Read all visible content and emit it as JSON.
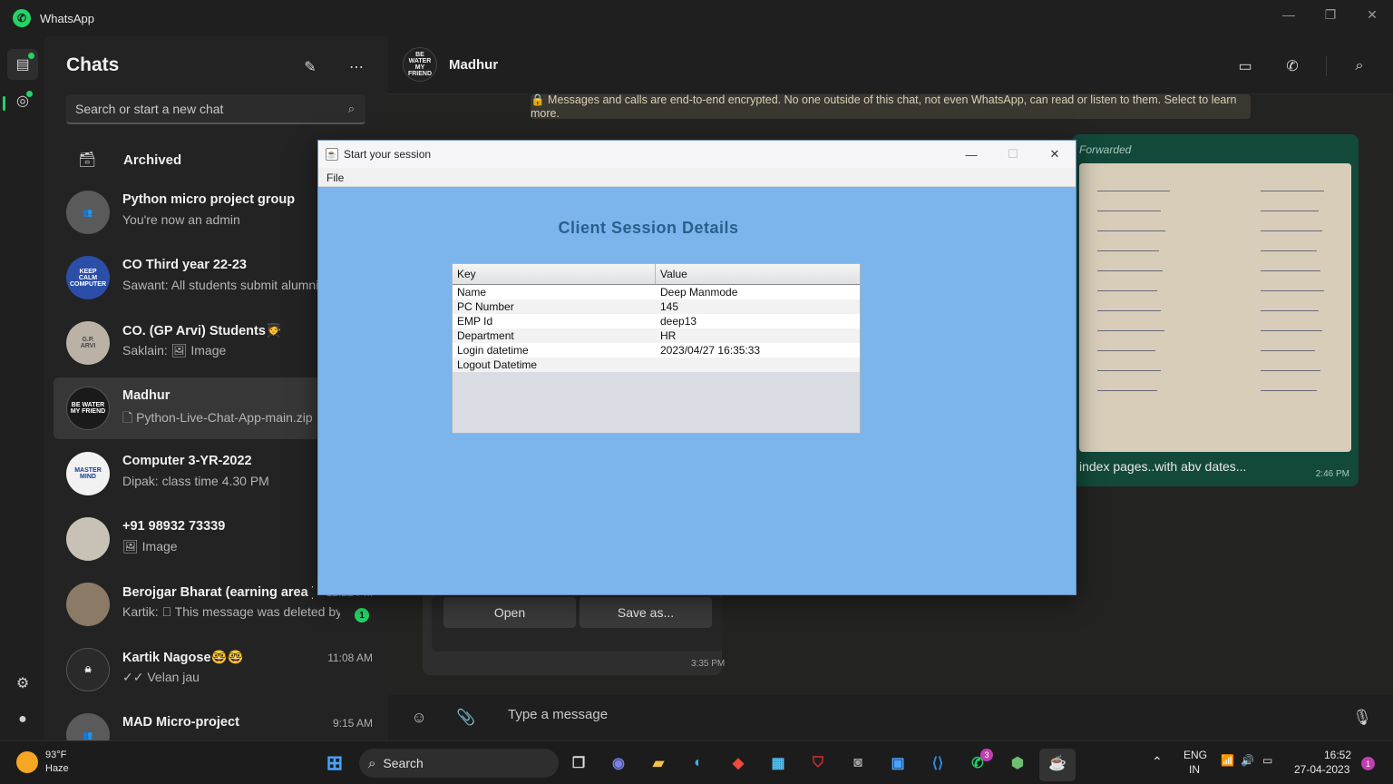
{
  "window": {
    "title": "WhatsApp"
  },
  "chats": {
    "header": "Chats",
    "search_placeholder": "Search or start a new chat",
    "archived_label": "Archived",
    "items": [
      {
        "name": "Python micro project group",
        "preview": "You're now an admin",
        "time": "",
        "avatar": "group"
      },
      {
        "name": "CO Third year 22-23",
        "preview": "Sawant: All students submit alumni",
        "time": "",
        "avatar": "KEEP CALM COMPUTER GINEERS"
      },
      {
        "name": "CO. (GP Arvi) Students🧑‍🎓",
        "preview": "Saklain: 🖼 Image",
        "time": "",
        "avatar": "G.P. ARVI"
      },
      {
        "name": "Madhur",
        "preview": "🗋 Python-Live-Chat-App-main.zip",
        "time": "",
        "avatar": "BE WATER MY FRIEND"
      },
      {
        "name": "Computer 3-YR-2022",
        "preview": "Dipak: class time 4.30 PM",
        "time": "",
        "avatar": "MASTER MIND"
      },
      {
        "name": "+91 98932 73339",
        "preview": "🖼 Image",
        "time": "",
        "avatar": ""
      },
      {
        "name": "Berojgar Bharat (earning area ) 💰",
        "preview": "Kartik: ⃠ This message was deleted by...",
        "time": "12:22 PM",
        "avatar": "",
        "unread": "1"
      },
      {
        "name": "Kartik Nagose🤓🤓",
        "preview": "✓✓ Velan jau",
        "time": "11:08 AM",
        "avatar": ""
      },
      {
        "name": "MAD Micro-project",
        "preview": "✓✓ ...",
        "time": "9:15 AM",
        "avatar": "group"
      }
    ]
  },
  "conversation": {
    "name": "Madhur",
    "avatar_text": "BE WATER MY FRIEND",
    "encryption_notice": "🔒 Messages and calls are end-to-end encrypted. No one outside of this chat, not even WhatsApp, can read or listen to them. Select to learn more.",
    "image_message": {
      "forwarded": "Forwarded",
      "caption": "index pages..with abv dates...",
      "time": "2:46 PM"
    },
    "file_message": {
      "open_label": "Open",
      "save_label": "Save as...",
      "time": "3:35 PM"
    },
    "composer_placeholder": "Type a message"
  },
  "dialog": {
    "title": "Start your session",
    "menu": [
      "File"
    ],
    "heading": "Client Session Details",
    "columns": [
      "Key",
      "Value"
    ],
    "rows": [
      {
        "key": "Name",
        "value": "Deep Manmode"
      },
      {
        "key": "PC Number",
        "value": "145"
      },
      {
        "key": "EMP Id",
        "value": "deep13"
      },
      {
        "key": "Department",
        "value": "HR"
      },
      {
        "key": "Login datetime",
        "value": "2023/04/27 16:35:33"
      },
      {
        "key": "Logout Datetime",
        "value": ""
      }
    ]
  },
  "taskbar": {
    "weather_temp": "93°F",
    "weather_desc": "Haze",
    "search_label": "Search",
    "whatsapp_badge": "3",
    "lang": "ENG",
    "region": "IN",
    "time": "16:52",
    "date": "27-04-2023",
    "notification_count": "1"
  },
  "colors": {
    "accent": "#25d366",
    "dialog_bg": "#7cb5ec",
    "heading": "#2a5f8c"
  }
}
